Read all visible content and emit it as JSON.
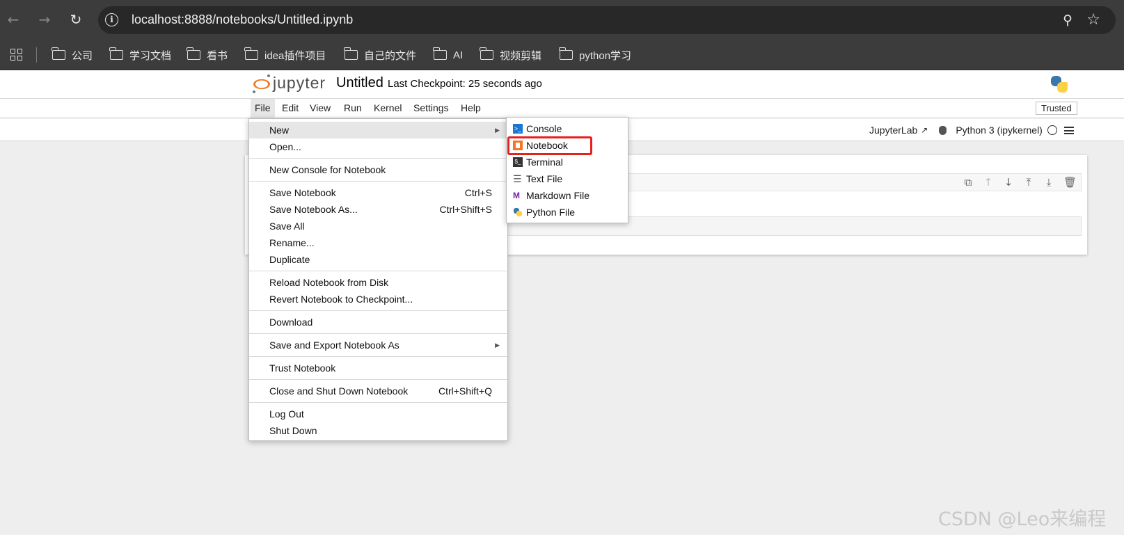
{
  "browser": {
    "url": "localhost:8888/notebooks/Untitled.ipynb",
    "bookmarks": [
      "公司",
      "学习文档",
      "看书",
      "idea插件项目",
      "自己的文件",
      "AI",
      "视频剪辑",
      "python学习"
    ]
  },
  "header": {
    "brand": "jupyter",
    "notebook_title": "Untitled",
    "checkpoint": "Last Checkpoint: 25 seconds ago"
  },
  "menubar": {
    "items": [
      "File",
      "Edit",
      "View",
      "Run",
      "Kernel",
      "Settings",
      "Help"
    ],
    "trusted": "Trusted"
  },
  "toolbar": {
    "jupyterlab": "JupyterLab",
    "kernel": "Python 3 (ipykernel)"
  },
  "file_menu": {
    "items": [
      {
        "label": "New",
        "shortcut": "",
        "submenu": true
      },
      {
        "label": "Open...",
        "shortcut": ""
      },
      {
        "label": "New Console for Notebook",
        "shortcut": ""
      },
      {
        "label": "Save Notebook",
        "shortcut": "Ctrl+S"
      },
      {
        "label": "Save Notebook As...",
        "shortcut": "Ctrl+Shift+S"
      },
      {
        "label": "Save All",
        "shortcut": ""
      },
      {
        "label": "Rename...",
        "shortcut": ""
      },
      {
        "label": "Duplicate",
        "shortcut": ""
      },
      {
        "label": "Reload Notebook from Disk",
        "shortcut": ""
      },
      {
        "label": "Revert Notebook to Checkpoint...",
        "shortcut": ""
      },
      {
        "label": "Download",
        "shortcut": ""
      },
      {
        "label": "Save and Export Notebook As",
        "shortcut": "",
        "submenu": true
      },
      {
        "label": "Trust Notebook",
        "shortcut": ""
      },
      {
        "label": "Close and Shut Down Notebook",
        "shortcut": "Ctrl+Shift+Q"
      },
      {
        "label": "Log Out",
        "shortcut": ""
      },
      {
        "label": "Shut Down",
        "shortcut": ""
      }
    ]
  },
  "new_menu": {
    "items": [
      "Console",
      "Notebook",
      "Terminal",
      "Text File",
      "Markdown File",
      "Python File"
    ]
  },
  "colors": {
    "jupyter_orange": "#f37726",
    "highlight_red": "#e8201c",
    "console_blue": "#1976d2",
    "markdown_purple": "#7b1fa2"
  },
  "watermark": "CSDN @Leo来编程"
}
